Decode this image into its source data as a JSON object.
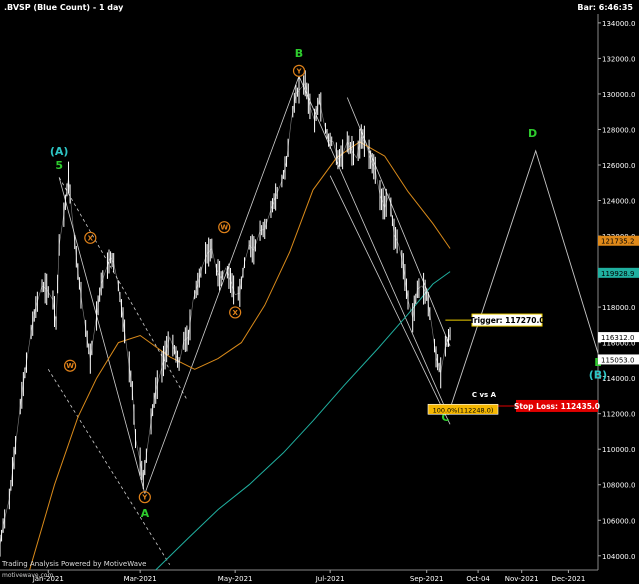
{
  "header": {
    "title": ".BVSP (Blue Count) - 1 day",
    "bar_time": "Bar: 6:46:35"
  },
  "footer": {
    "credit": "Trading Analysis Powered by MotiveWave",
    "watermark": "motivewave.com"
  },
  "colors": {
    "background": "#000000",
    "price": "#ffffff",
    "wave_green": "#2ecc2e",
    "wave_cyan": "#2ec4c4",
    "wave_orange": "#e0821a",
    "ma_fast": "#d98a1a",
    "ma_slow": "#20b0a0",
    "trigger_box": "#f0d000",
    "stop_box": "#e00000",
    "projection": "#c8c8c8"
  },
  "chart_data": {
    "type": "line",
    "title": ".BVSP (Blue Count) - 1 day",
    "xlabel": "",
    "ylabel": "",
    "ylim": [
      103200,
      134500
    ],
    "xlim": [
      "2020-12-01",
      "2021-12-20"
    ],
    "y_ticks": [
      104000,
      106000,
      108000,
      110000,
      112000,
      114000,
      116000,
      118000,
      120000,
      122000,
      124000,
      126000,
      128000,
      130000,
      132000,
      134000
    ],
    "y_tick_labels": [
      "104000.0",
      "106000.0",
      "108000.0",
      "110000.0",
      "112000.0",
      "114000.0",
      "116000.0",
      "118000.0",
      "120000.0",
      "122000.0",
      "124000.0",
      "126000.0",
      "128000.0",
      "130000.0",
      "132000.0",
      "134000.0"
    ],
    "x_ticks": [
      {
        "date": "2021-01-01",
        "label": "Jan-2021"
      },
      {
        "date": "2021-03-01",
        "label": "Mar-2021"
      },
      {
        "date": "2021-05-01",
        "label": "May-2021"
      },
      {
        "date": "2021-07-01",
        "label": "Jul-2021"
      },
      {
        "date": "2021-09-01",
        "label": "Sep-2021"
      },
      {
        "date": "2021-10-04",
        "label": "Oct-04"
      },
      {
        "date": "2021-11-01",
        "label": "Nov-2021"
      },
      {
        "date": "2021-12-01",
        "label": "Dec-2021"
      }
    ],
    "grid": false,
    "series": [
      {
        "kind": "price",
        "points": [
          [
            "2020-11-30",
            104000
          ],
          [
            "2020-12-03",
            105700
          ],
          [
            "2020-12-07",
            107200
          ],
          [
            "2020-12-10",
            109500
          ],
          [
            "2020-12-14",
            112400
          ],
          [
            "2020-12-17",
            114300
          ],
          [
            "2020-12-21",
            116600
          ],
          [
            "2020-12-24",
            118000
          ],
          [
            "2020-12-28",
            119200
          ],
          [
            "2020-12-31",
            119000
          ],
          [
            "2021-01-04",
            118400
          ],
          [
            "2021-01-06",
            117100
          ],
          [
            "2021-01-08",
            121500
          ],
          [
            "2021-01-11",
            123200
          ],
          [
            "2021-01-14",
            125300
          ],
          [
            "2021-01-17",
            122500
          ],
          [
            "2021-01-20",
            120000
          ],
          [
            "2021-01-23",
            118000
          ],
          [
            "2021-01-26",
            116200
          ],
          [
            "2021-01-28",
            115100
          ],
          [
            "2021-02-01",
            117500
          ],
          [
            "2021-02-04",
            119300
          ],
          [
            "2021-02-07",
            120100
          ],
          [
            "2021-02-10",
            120800
          ],
          [
            "2021-02-12",
            120500
          ],
          [
            "2021-02-15",
            119200
          ],
          [
            "2021-02-18",
            117300
          ],
          [
            "2021-02-21",
            115300
          ],
          [
            "2021-02-24",
            113300
          ],
          [
            "2021-02-26",
            110600
          ],
          [
            "2021-03-01",
            109300
          ],
          [
            "2021-03-03",
            108300
          ],
          [
            "2021-03-06",
            110300
          ],
          [
            "2021-03-09",
            112200
          ],
          [
            "2021-03-11",
            113300
          ],
          [
            "2021-03-14",
            114300
          ],
          [
            "2021-03-17",
            115300
          ],
          [
            "2021-03-20",
            116300
          ],
          [
            "2021-03-23",
            115600
          ],
          [
            "2021-03-26",
            114800
          ],
          [
            "2021-03-29",
            116100
          ],
          [
            "2021-04-01",
            116300
          ],
          [
            "2021-04-04",
            118400
          ],
          [
            "2021-04-07",
            119300
          ],
          [
            "2021-04-10",
            120300
          ],
          [
            "2021-04-13",
            121000
          ],
          [
            "2021-04-16",
            121300
          ],
          [
            "2021-04-19",
            120100
          ],
          [
            "2021-04-22",
            119600
          ],
          [
            "2021-04-25",
            120200
          ],
          [
            "2021-04-28",
            119500
          ],
          [
            "2021-05-01",
            118700
          ],
          [
            "2021-05-04",
            118800
          ],
          [
            "2021-05-07",
            120500
          ],
          [
            "2021-05-10",
            121500
          ],
          [
            "2021-05-13",
            121200
          ],
          [
            "2021-05-17",
            122300
          ],
          [
            "2021-05-20",
            122400
          ],
          [
            "2021-05-24",
            123500
          ],
          [
            "2021-05-27",
            124200
          ],
          [
            "2021-05-31",
            125100
          ],
          [
            "2021-06-03",
            126200
          ],
          [
            "2021-06-06",
            128500
          ],
          [
            "2021-06-09",
            130000
          ],
          [
            "2021-06-12",
            130300
          ],
          [
            "2021-06-15",
            130600
          ],
          [
            "2021-06-18",
            129300
          ],
          [
            "2021-06-21",
            128500
          ],
          [
            "2021-06-24",
            129700
          ],
          [
            "2021-06-27",
            128400
          ],
          [
            "2021-06-30",
            127400
          ],
          [
            "2021-07-03",
            127300
          ],
          [
            "2021-07-06",
            126300
          ],
          [
            "2021-07-09",
            126600
          ],
          [
            "2021-07-12",
            127300
          ],
          [
            "2021-07-15",
            126800
          ],
          [
            "2021-07-18",
            126400
          ],
          [
            "2021-07-21",
            127600
          ],
          [
            "2021-07-24",
            127200
          ],
          [
            "2021-07-27",
            126300
          ],
          [
            "2021-07-30",
            125700
          ],
          [
            "2021-08-02",
            124300
          ],
          [
            "2021-08-05",
            123600
          ],
          [
            "2021-08-08",
            124400
          ],
          [
            "2021-08-11",
            122100
          ],
          [
            "2021-08-14",
            121500
          ],
          [
            "2021-08-17",
            120300
          ],
          [
            "2021-08-20",
            118400
          ],
          [
            "2021-08-23",
            117400
          ],
          [
            "2021-08-26",
            119000
          ],
          [
            "2021-08-29",
            119200
          ],
          [
            "2021-09-01",
            118700
          ],
          [
            "2021-09-04",
            117100
          ],
          [
            "2021-09-07",
            115200
          ],
          [
            "2021-09-10",
            114300
          ],
          [
            "2021-09-13",
            115800
          ],
          [
            "2021-09-16",
            116500
          ]
        ]
      },
      {
        "kind": "moving_average",
        "points": [
          [
            "2020-12-20",
            103200
          ],
          [
            "2021-01-05",
            108000
          ],
          [
            "2021-01-20",
            111800
          ],
          [
            "2021-02-01",
            114000
          ],
          [
            "2021-02-15",
            116000
          ],
          [
            "2021-03-01",
            116400
          ],
          [
            "2021-03-20",
            115200
          ],
          [
            "2021-04-05",
            114500
          ],
          [
            "2021-04-20",
            115100
          ],
          [
            "2021-05-05",
            116000
          ],
          [
            "2021-05-20",
            118100
          ],
          [
            "2021-06-05",
            121100
          ],
          [
            "2021-06-20",
            124600
          ],
          [
            "2021-07-05",
            126400
          ],
          [
            "2021-07-20",
            127300
          ],
          [
            "2021-08-05",
            126500
          ],
          [
            "2021-08-20",
            124500
          ],
          [
            "2021-09-05",
            122700
          ],
          [
            "2021-09-16",
            121300
          ]
        ]
      },
      {
        "kind": "moving_average",
        "points": [
          [
            "2021-03-11",
            103200
          ],
          [
            "2021-04-01",
            105000
          ],
          [
            "2021-04-20",
            106600
          ],
          [
            "2021-05-10",
            108000
          ],
          [
            "2021-06-01",
            109800
          ],
          [
            "2021-06-20",
            111600
          ],
          [
            "2021-07-10",
            113600
          ],
          [
            "2021-08-01",
            115700
          ],
          [
            "2021-08-20",
            117600
          ],
          [
            "2021-09-05",
            119300
          ],
          [
            "2021-09-16",
            120000
          ]
        ]
      },
      {
        "kind": "projection",
        "points": [
          [
            "2021-09-16",
            112300
          ],
          [
            "2021-11-10",
            126800
          ],
          [
            "2021-12-20",
            115400
          ]
        ]
      }
    ],
    "wave_labels": [
      {
        "text": "(A)",
        "date": "2021-01-08",
        "price": 126800,
        "color": "cyan"
      },
      {
        "text": "5",
        "date": "2021-01-08",
        "price": 126000,
        "color": "green"
      },
      {
        "text": "X",
        "date": "2021-01-28",
        "price": 121900,
        "color": "orange",
        "circled": true
      },
      {
        "text": "W",
        "date": "2021-01-15",
        "price": 114700,
        "color": "orange",
        "circled": true
      },
      {
        "text": "Y",
        "date": "2021-03-04",
        "price": 107300,
        "color": "orange",
        "circled": true
      },
      {
        "text": "A",
        "date": "2021-03-04",
        "price": 106400,
        "color": "green"
      },
      {
        "text": "W",
        "date": "2021-04-24",
        "price": 122500,
        "color": "orange",
        "circled": true
      },
      {
        "text": "X",
        "date": "2021-05-01",
        "price": 117700,
        "color": "orange",
        "circled": true
      },
      {
        "text": "Y",
        "date": "2021-06-11",
        "price": 131300,
        "color": "orange",
        "circled": true
      },
      {
        "text": "B",
        "date": "2021-06-11",
        "price": 132300,
        "color": "green"
      },
      {
        "text": "C",
        "date": "2021-09-13",
        "price": 111800,
        "color": "green"
      },
      {
        "text": "D",
        "date": "2021-11-08",
        "price": 127800,
        "color": "green"
      },
      {
        "text": "E",
        "date": "2021-12-20",
        "price": 114900,
        "color": "green"
      },
      {
        "text": "(B)",
        "date": "2021-12-20",
        "price": 114200,
        "color": "cyan"
      }
    ],
    "annotations": {
      "trigger": {
        "label": "Trigger: 117270.0",
        "price": 117270
      },
      "stop_loss": {
        "label": "Stop Loss: 112435.0",
        "price": 112435
      },
      "c_vs_a": {
        "label": "C vs A",
        "ratio": "100.0%",
        "price": 112248,
        "ratio_label": "100.0%(112248.0)"
      },
      "axis_markers": [
        {
          "price": 121735.2,
          "label": "121735.2",
          "color": "orange"
        },
        {
          "price": 119928.9,
          "label": "119928.9",
          "color": "teal"
        },
        {
          "price": 116312,
          "label": "116312.0",
          "color": "white"
        },
        {
          "price": 115053,
          "label": "115053.0",
          "color": "white"
        }
      ]
    }
  }
}
